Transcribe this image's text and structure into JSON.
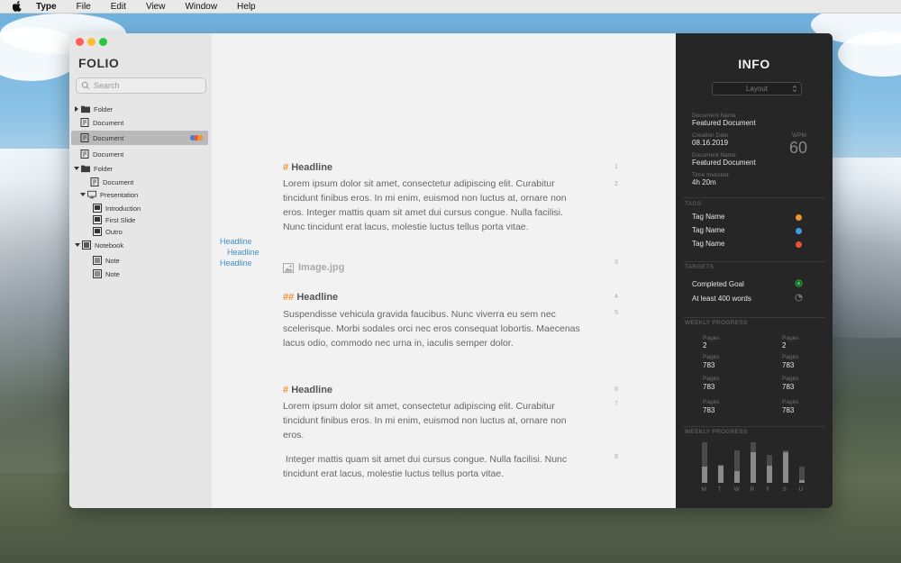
{
  "menubar": {
    "app_name": "Type",
    "items": [
      "File",
      "Edit",
      "View",
      "Window",
      "Help"
    ]
  },
  "sidebar": {
    "title": "FOLIO",
    "search_placeholder": "Search",
    "items": [
      {
        "label": "Folder",
        "type": "folder",
        "expanded": false
      },
      {
        "label": "Document",
        "type": "document"
      },
      {
        "label": "Document",
        "type": "document",
        "selected": true
      },
      {
        "label": "Document",
        "type": "document"
      },
      {
        "label": "Folder",
        "type": "folder",
        "expanded": true
      },
      {
        "label": "Document",
        "type": "document"
      },
      {
        "label": "Presentation",
        "type": "presentation",
        "expanded": true
      },
      {
        "label": "Introduction",
        "type": "slide"
      },
      {
        "label": "First Slide",
        "type": "slide"
      },
      {
        "label": "Outro",
        "type": "slide"
      },
      {
        "label": "Notebook",
        "type": "notebook",
        "expanded": true
      },
      {
        "label": "Note",
        "type": "note"
      },
      {
        "label": "Note",
        "type": "note"
      }
    ],
    "selected_dots": [
      "#e8533f",
      "#3d7be0",
      "#f0952c"
    ]
  },
  "outline": {
    "headings": [
      "Headline",
      "Headline",
      "Headline"
    ]
  },
  "editor": {
    "blocks": [
      {
        "hash": "#",
        "title": "Headline"
      },
      {
        "text": "Lorem ipsum dolor sit amet, consectetur adipiscing elit. Curabitur tincidunt finibus eros. In mi enim, euismod non luctus at, ornare non eros. Integer mattis quam sit amet dui cursus congue. Nulla facilisi. Nunc tincidunt erat lacus, molestie luctus tellus porta vitae."
      },
      {
        "image": "Image.jpg"
      },
      {
        "hash": "##",
        "title": "Headline"
      },
      {
        "text": "Suspendisse vehicula gravida faucibus. Nunc viverra eu sem nec scelerisque. Morbi sodales orci nec eros consequat lobortis. Maecenas lacus odio, commodo nec urna in, iaculis semper dolor."
      },
      {
        "hash": "#",
        "title": "Headline"
      },
      {
        "text": "Lorem ipsum dolor sit amet, consectetur adipiscing elit. Curabitur tincidunt finibus eros. In mi enim, euismod non luctus at, ornare non eros."
      },
      {
        "text": " Integer mattis quam sit amet dui cursus congue. Nulla facilisi. Nunc tincidunt erat lacus, molestie luctus tellus porta vitae."
      }
    ],
    "line_numbers": [
      "1",
      "2",
      "3",
      "4",
      "5",
      "6",
      "7",
      "8"
    ]
  },
  "info": {
    "title": "INFO",
    "layout_label": "Layout",
    "document_name_label": "Document Name",
    "document_name": "Featured Document",
    "creation_date_label": "Creation Date",
    "creation_date": "08.16.2019",
    "wpm_label": "WPM",
    "wpm": "60",
    "document_name_label_2": "Document Name",
    "document_name_2": "Featured Document",
    "time_invested_label": "Time Invested",
    "time_invested": "4h 20m",
    "tags_section": "TAGS",
    "tags": [
      {
        "name": "Tag Name",
        "color": "#f0952c"
      },
      {
        "name": "Tag Name",
        "color": "#3d9be0"
      },
      {
        "name": "Tag Name",
        "color": "#e8533f"
      }
    ],
    "targets_section": "TARGETS",
    "targets": [
      {
        "label": "Completed Goal",
        "status": "complete"
      },
      {
        "label": "At least 400 words",
        "status": "pending"
      }
    ],
    "weekly_section": "WEEKLY PROGRESS",
    "weekly_stats": [
      {
        "label": "Pages",
        "value": "2"
      },
      {
        "label": "Pages",
        "value": "2"
      },
      {
        "label": "Pages",
        "value": "783"
      },
      {
        "label": "Pages",
        "value": "783"
      },
      {
        "label": "Pages",
        "value": "783"
      },
      {
        "label": "Pages",
        "value": "783"
      },
      {
        "label": "Pages",
        "value": "783"
      },
      {
        "label": "Pages",
        "value": "783"
      }
    ],
    "weekly_section_2": "WEEKLY PROGRESS",
    "days": [
      "M",
      "T",
      "W",
      "R",
      "F",
      "S",
      "U"
    ],
    "day_progress": [
      0.4,
      0.95,
      0.35,
      0.75,
      0.6,
      0.95,
      0.15
    ],
    "day_totals": [
      1.0,
      0.45,
      0.8,
      1.0,
      0.7,
      0.8,
      0.4
    ]
  }
}
